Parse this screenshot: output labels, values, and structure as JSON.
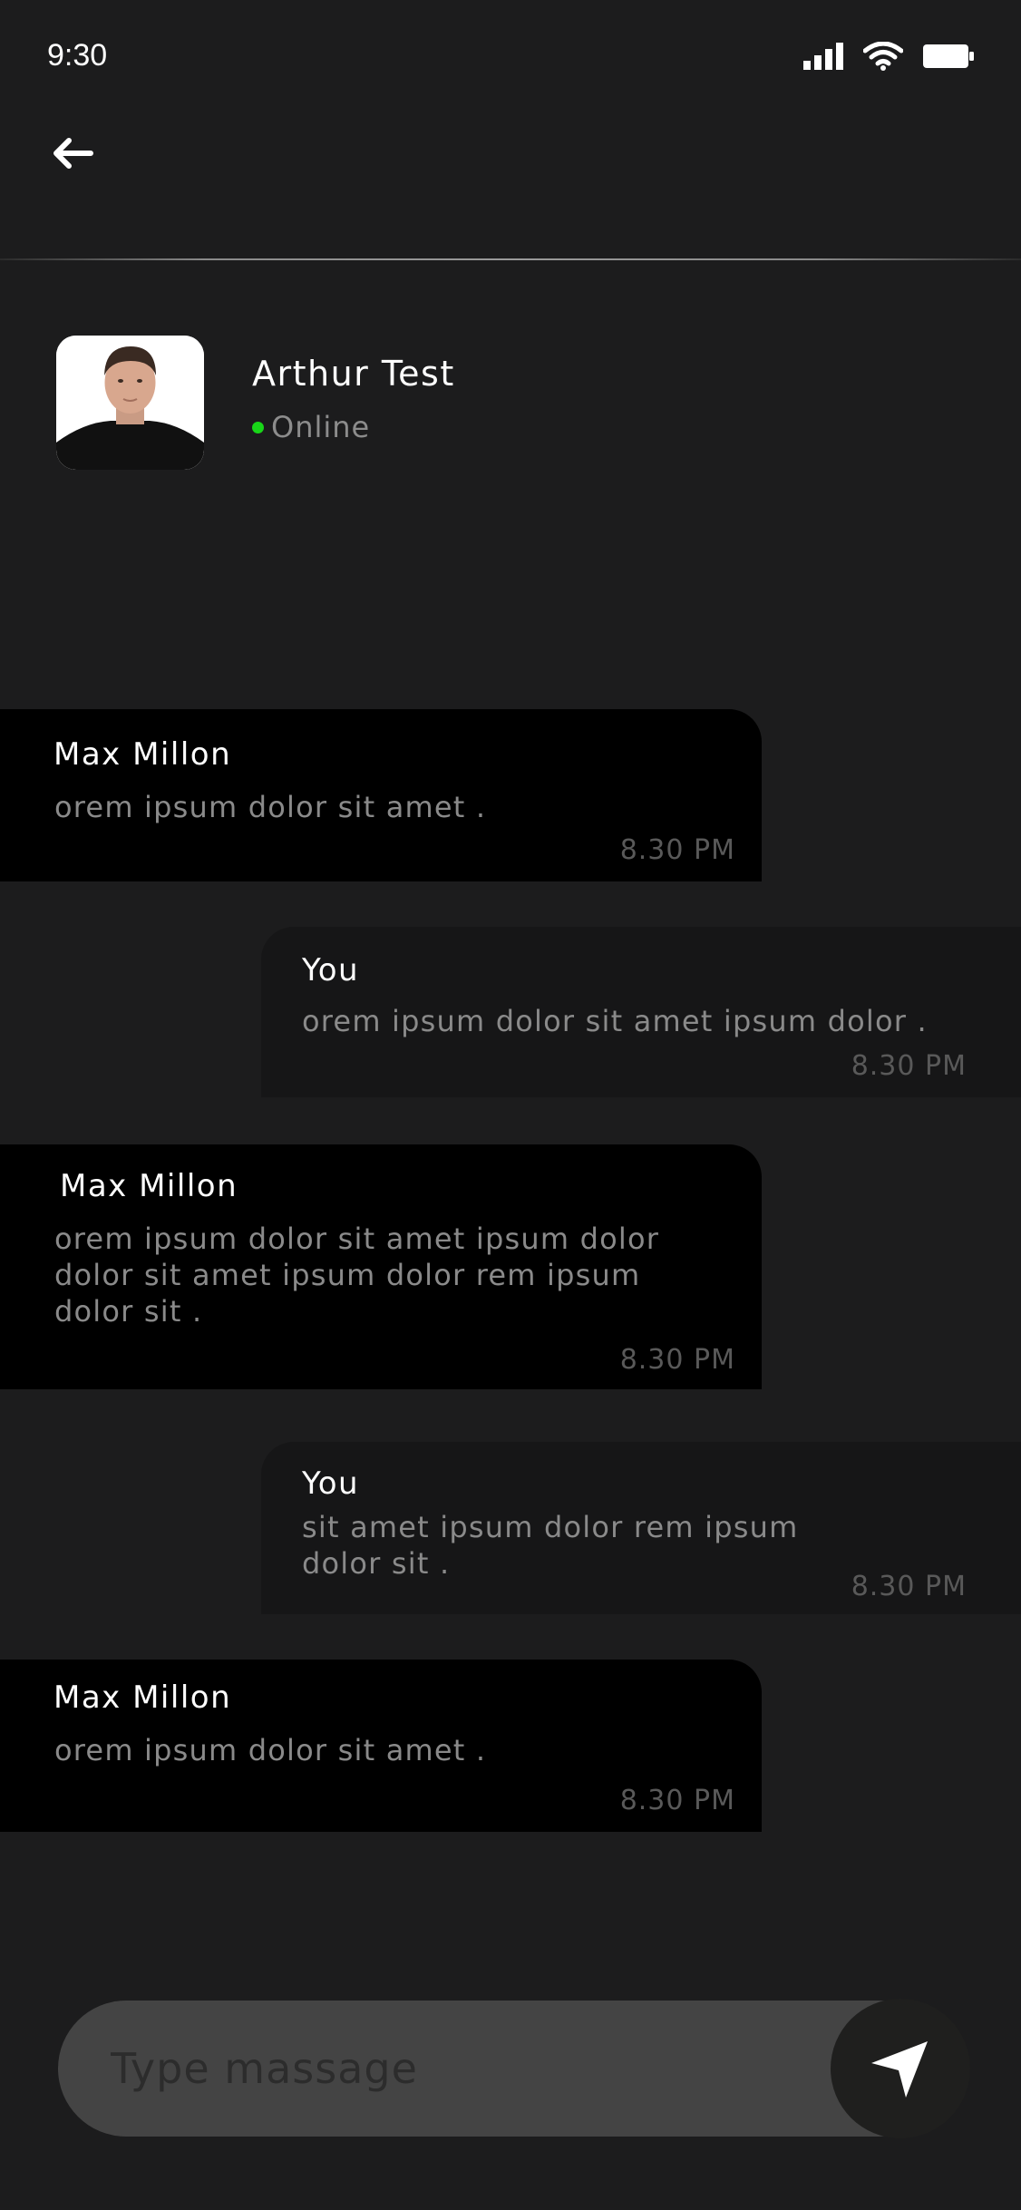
{
  "status_bar": {
    "time": "9:30",
    "icons": [
      "signal-icon",
      "wifi-icon",
      "battery-icon"
    ]
  },
  "header": {
    "back_icon": "back-arrow-icon"
  },
  "contact": {
    "name": "Arthur Test",
    "status": "Online",
    "status_color": "#18d618"
  },
  "messages": [
    {
      "direction": "received",
      "sender": "Max Millon",
      "lines": [
        "orem ipsum dolor sit amet ."
      ],
      "time": "8.30 PM"
    },
    {
      "direction": "sent",
      "sender": "You",
      "lines": [
        "orem ipsum dolor sit amet  ipsum dolor ."
      ],
      "time": "8.30 PM"
    },
    {
      "direction": "received",
      "sender": "Max Millon",
      "lines": [
        "orem ipsum dolor sit amet  ipsum dolor",
        "dolor sit amet  ipsum dolor rem ipsum",
        "dolor sit ."
      ],
      "time": "8.30 PM"
    },
    {
      "direction": "sent",
      "sender": "You",
      "lines": [
        "sit amet  ipsum dolor rem ipsum",
        "dolor sit ."
      ],
      "time": "8.30 PM"
    },
    {
      "direction": "received",
      "sender": "Max Millon",
      "lines": [
        "orem ipsum dolor sit amet ."
      ],
      "time": "8.30 PM"
    }
  ],
  "composer": {
    "placeholder": "Type massage",
    "value": "",
    "send_icon": "send-icon"
  },
  "colors": {
    "background": "#1c1c1d",
    "received_bubble": "#000000",
    "sent_bubble": "#161617",
    "composer": "#444444",
    "send_button": "#1f1f1e"
  }
}
